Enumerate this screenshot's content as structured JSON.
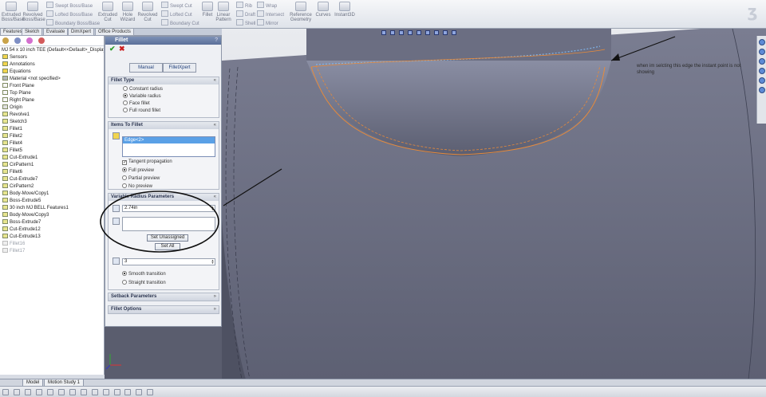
{
  "toolbar": {
    "extruded_boss": "Extruded Boss/Base",
    "revolved_boss": "Revolved Boss/Base",
    "swept_boss": "Swept Boss/Base",
    "lofted_boss": "Lofted Boss/Base",
    "boundary_boss": "Boundary Boss/Base",
    "extruded_cut": "Extruded Cut",
    "hole_wizard": "Hole Wizard",
    "revolved_cut": "Revolved Cut",
    "swept_cut": "Swept Cut",
    "lofted_cut": "Lofted Cut",
    "boundary_cut": "Boundary Cut",
    "fillet": "Fillet",
    "linear_pattern": "Linear Pattern",
    "rib": "Rib",
    "draft": "Draft",
    "shell": "Shell",
    "wrap": "Wrap",
    "intersect": "Intersect",
    "mirror": "Mirror",
    "reference_geometry": "Reference Geometry",
    "curves": "Curves",
    "instant3d": "Instant3D"
  },
  "manager_tabs": [
    "Features",
    "Sketch",
    "Evaluate",
    "DimXpert",
    "Office Products"
  ],
  "tree": {
    "root": "MJ 54 x 10 inch TEE (Default<<Default>_Display",
    "items": [
      "Sensors",
      "Annotations",
      "Equations",
      "Material <not specified>",
      "Front Plane",
      "Top Plane",
      "Right Plane",
      "Origin",
      "Revolve1",
      "Sketch3",
      "Fillet1",
      "Fillet2",
      "Fillet4",
      "Fillet5",
      "Cut-Extrude1",
      "CirPattern1",
      "Fillet6",
      "Cut-Extrude7",
      "CirPattern2",
      "Body-Move/Copy1",
      "Boss-Extrude5",
      "30 inch MJ BELL Features1",
      "Body-Move/Copy3",
      "Boss-Extrude7",
      "Cut-Extrude12",
      "Cut-Extrude13"
    ],
    "suppressed_items": [
      "Fillet16",
      "Fillet17"
    ]
  },
  "property_manager": {
    "title": "Fillet",
    "help": "?",
    "ok_icon": "✔",
    "cancel_icon": "✖",
    "mode_manual": "Manual",
    "mode_filletxpert": "FilletXpert",
    "fillet_type": {
      "header": "Fillet Type",
      "options": [
        "Constant radius",
        "Variable radius",
        "Face fillet",
        "Full round fillet"
      ],
      "selected": "Variable radius"
    },
    "items_to_fillet": {
      "header": "Items To Fillet",
      "selection": "Edge<2>",
      "tangent_propagation": "Tangent propagation",
      "tangent_checked": "✓",
      "preview_options": [
        "Full preview",
        "Partial preview",
        "No preview"
      ],
      "preview_selected": "Full preview"
    },
    "variable_radius": {
      "header": "Variable Radius Parameters",
      "radius_value": "2.74in",
      "set_unassigned": "Set Unassigned",
      "set_all": "Set All",
      "instances": "3",
      "transitions": [
        "Smooth transition",
        "Straight transition"
      ],
      "transition_selected": "Smooth transition"
    },
    "setback_header": "Setback Parameters",
    "fillet_options_header": "Fillet Options"
  },
  "annotation": {
    "text": "when im selcting this edge the instant point is not showing"
  },
  "bottom_tabs": [
    "Model",
    "Motion Study 1"
  ],
  "colors": {
    "body_fill": "#6d7085",
    "body_dark": "#585b6c",
    "edge_orange": "#e78a3a",
    "edge_blue": "#7fb3e8",
    "title_blue": "#5a6f98"
  }
}
